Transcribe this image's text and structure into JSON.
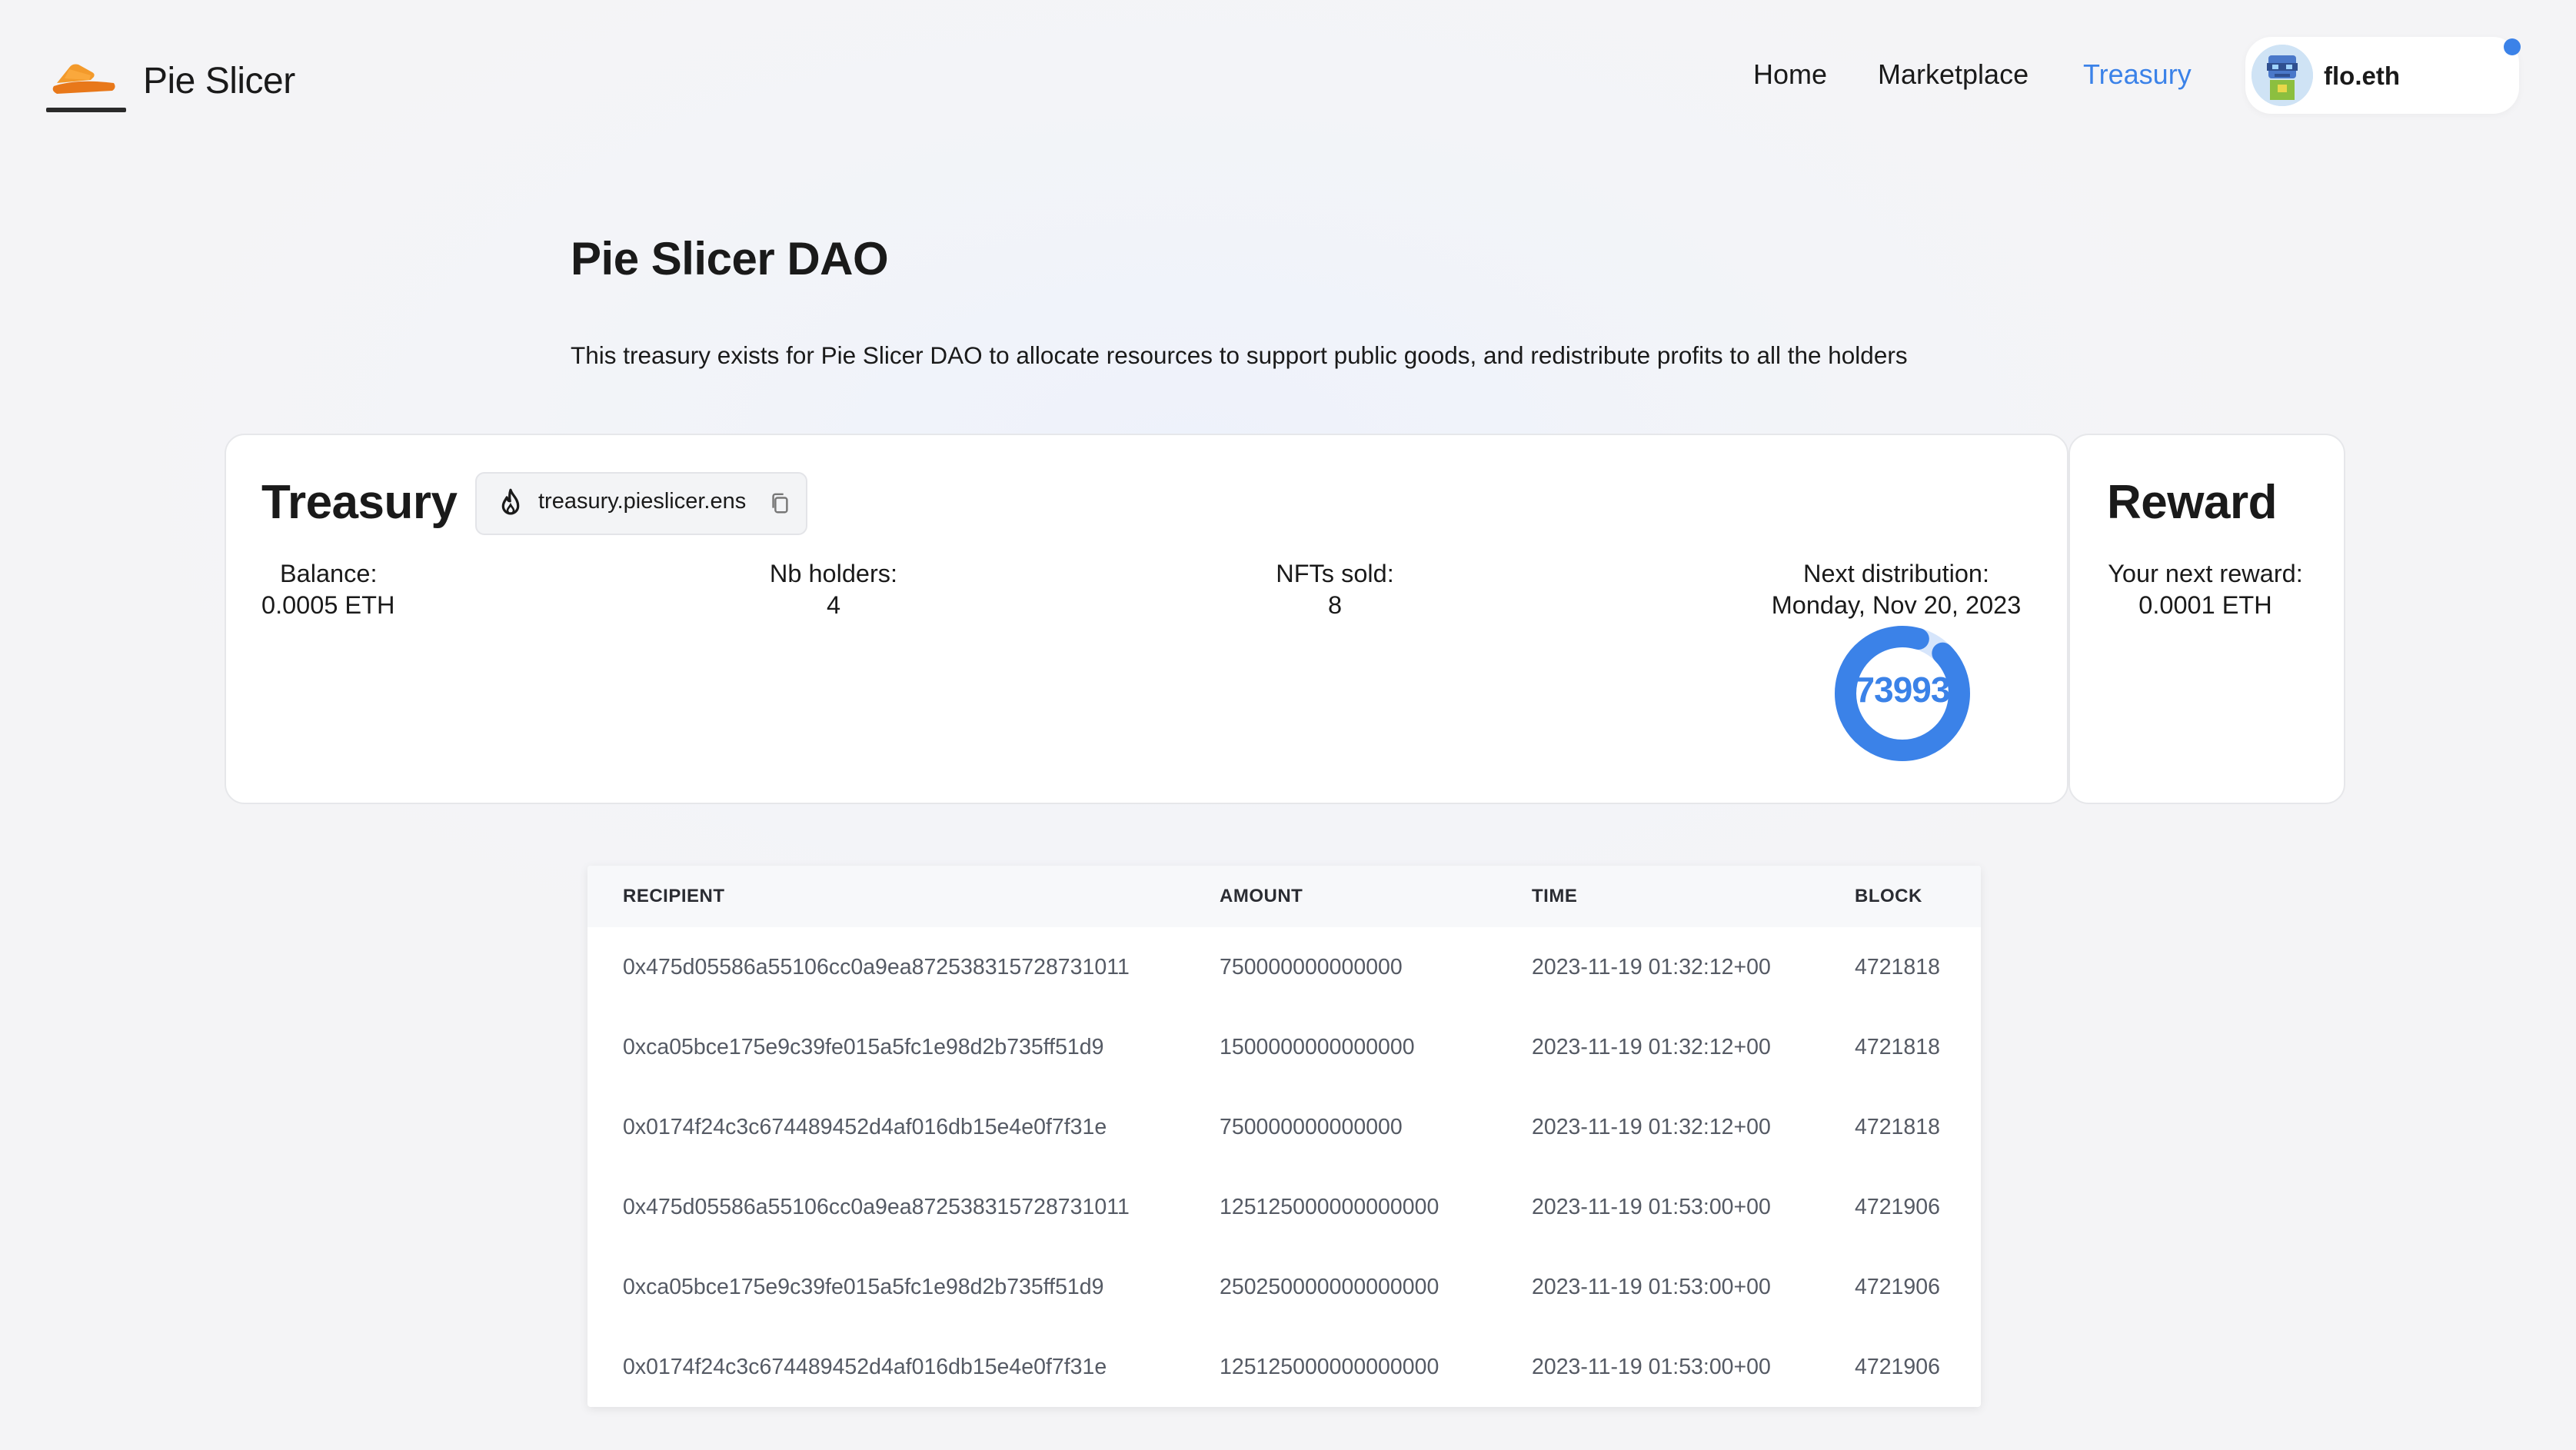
{
  "header": {
    "brand": "Pie Slicer",
    "nav": [
      "Home",
      "Marketplace",
      "Treasury"
    ],
    "active_nav": "Treasury",
    "account_name": "flo.eth"
  },
  "page": {
    "title": "Pie Slicer DAO",
    "description": "This treasury exists for Pie Slicer DAO to allocate resources to support public goods, and redistribute profits to all the holders"
  },
  "treasury": {
    "title": "Treasury",
    "ens": "treasury.pieslicer.ens",
    "balance_label": "Balance:",
    "balance_value": "0.0005 ETH",
    "holders_label": "Nb holders:",
    "holders_value": "4",
    "nfts_label": "NFTs sold:",
    "nfts_value": "8",
    "next_label": "Next distribution:",
    "next_value": "Monday, Nov 20, 2023",
    "countdown_value": "73993",
    "countdown_fill": 0.92
  },
  "reward": {
    "title": "Reward",
    "label": "Your next reward:",
    "value": "0.0001 ETH"
  },
  "table": {
    "headers": [
      "RECIPIENT",
      "AMOUNT",
      "TIME",
      "BLOCK"
    ],
    "rows": [
      [
        "0x475d05586a55106cc0a9ea872538315728731011",
        "750000000000000",
        "2023-11-19 01:32:12+00",
        "4721818"
      ],
      [
        "0xca05bce175e9c39fe015a5fc1e98d2b735ff51d9",
        "1500000000000000",
        "2023-11-19 01:32:12+00",
        "4721818"
      ],
      [
        "0x0174f24c3c674489452d4af016db15e4e0f7f31e",
        "750000000000000",
        "2023-11-19 01:32:12+00",
        "4721818"
      ],
      [
        "0x475d05586a55106cc0a9ea872538315728731011",
        "125125000000000000",
        "2023-11-19 01:53:00+00",
        "4721906"
      ],
      [
        "0xca05bce175e9c39fe015a5fc1e98d2b735ff51d9",
        "250250000000000000",
        "2023-11-19 01:53:00+00",
        "4721906"
      ],
      [
        "0x0174f24c3c674489452d4af016db15e4e0f7f31e",
        "125125000000000000",
        "2023-11-19 01:53:00+00",
        "4721906"
      ]
    ]
  },
  "colors": {
    "accent": "#3b82e8",
    "logo_orange": "#f08a1c",
    "notification": "#3b82e8"
  }
}
